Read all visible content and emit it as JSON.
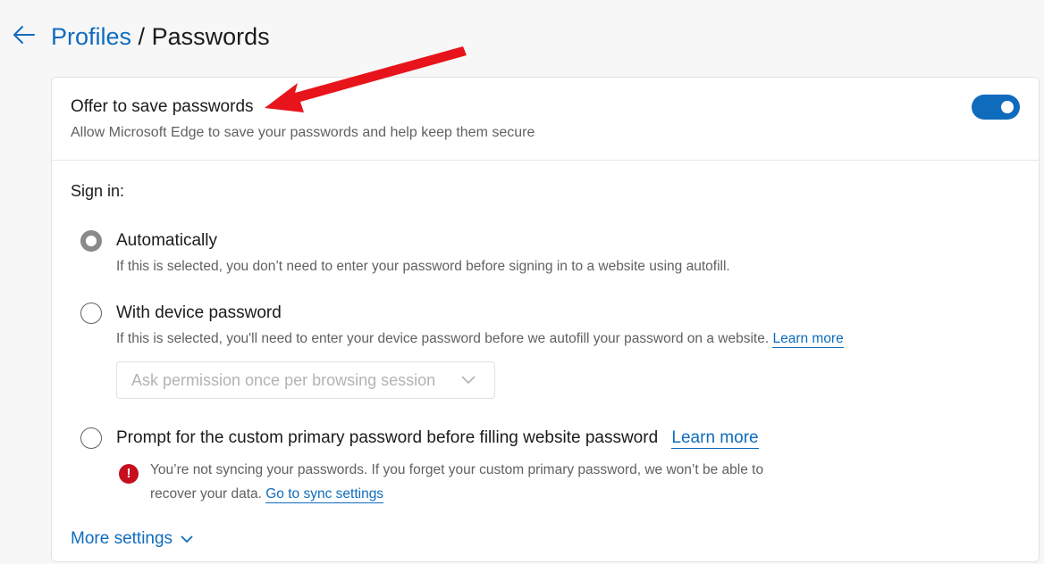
{
  "header": {
    "back_icon": "arrow-left-icon",
    "breadcrumb_parent": "Profiles",
    "breadcrumb_separator": "/",
    "breadcrumb_current": "Passwords"
  },
  "offer": {
    "title": "Offer to save passwords",
    "description": "Allow Microsoft Edge to save your passwords and help keep them secure",
    "toggle_on": true
  },
  "signin": {
    "label": "Sign in:",
    "options": [
      {
        "title": "Automatically",
        "description": "If this is selected, you don’t need to enter your password before signing in to a website using autofill.",
        "selected": true
      },
      {
        "title": "With device password",
        "description": "If this is selected, you'll need to enter your device password before we autofill your password on a website.",
        "learn_more": "Learn more",
        "selected": false,
        "dropdown_value": "Ask permission once per browsing session"
      },
      {
        "title": "Prompt for the custom primary password before filling website password",
        "learn_more": "Learn more",
        "selected": false,
        "warning_text": "You’re not syncing your passwords. If you forget your custom primary password, we won’t be able to recover your data.",
        "warning_link": "Go to sync settings"
      }
    ]
  },
  "more_settings": "More settings",
  "colors": {
    "accent": "#0f6cbd",
    "warning": "#c50f1f",
    "annotation_arrow": "#e8141b"
  }
}
